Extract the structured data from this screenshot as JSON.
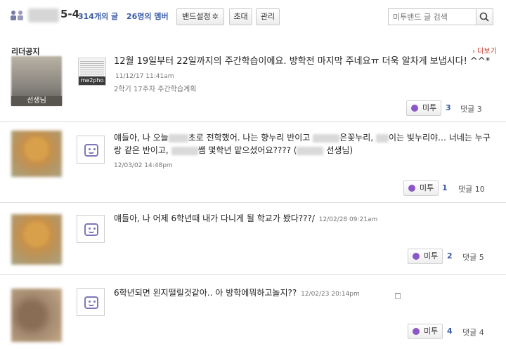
{
  "header": {
    "band_name_suffix": "5-4",
    "post_count": "314개의 글",
    "member_count": "26명의 멤버",
    "settings_label": "밴드설정",
    "invite_label": "초대",
    "manage_label": "관리",
    "search_placeholder": "미투밴드 글 검색"
  },
  "notice": {
    "section_title": "리더공지",
    "more_label": "› 더보기",
    "avatar_caption": "선생님",
    "thumb_label": "me2pho",
    "text": "12월 19일부터 22일까지의 주간학습이에요. 방학전 마지막 주네요ㅠ 더욱 알차게 보냅시다! ^^*",
    "timestamp": "11/12/17 11:41am",
    "subtitle": "2학기 17주차 주간학습계획",
    "metoo_label": "미투",
    "metoo_count": "3",
    "comments_label": "댓글 3"
  },
  "posts": [
    {
      "text_a": "얘들아, 나 오늘",
      "text_b": "초로 전학했어. 나는 향누리 반이고",
      "text_c": "은꽃누리,",
      "text_d": "이는 빛누리야… 너네는 누구랑 같은 반이고,",
      "text_e": "쌤 몇학년 맡으셨어요???? (",
      "text_f": "선생님)",
      "timestamp": "12/03/02 14:48pm",
      "metoo_label": "미투",
      "metoo_count": "1",
      "comments_label": "댓글 10"
    },
    {
      "text": "얘들아, 나 어제 6학년때 내가 다니게 될 학교가 봤다???/",
      "timestamp": "12/02/28 09:21am",
      "metoo_label": "미투",
      "metoo_count": "2",
      "comments_label": "댓글 5"
    },
    {
      "text": "6학년되면 왼지떨릴것같아.. 아 방학에뭐하고놀지??",
      "timestamp": "12/02/23 20:14pm",
      "metoo_label": "미투",
      "metoo_count": "4",
      "comments_label": "댓글 4"
    }
  ],
  "colors": {
    "accent_blue": "#3a5ba8",
    "metoo_purple": "#8a56c8",
    "more_red": "#c0392b"
  }
}
